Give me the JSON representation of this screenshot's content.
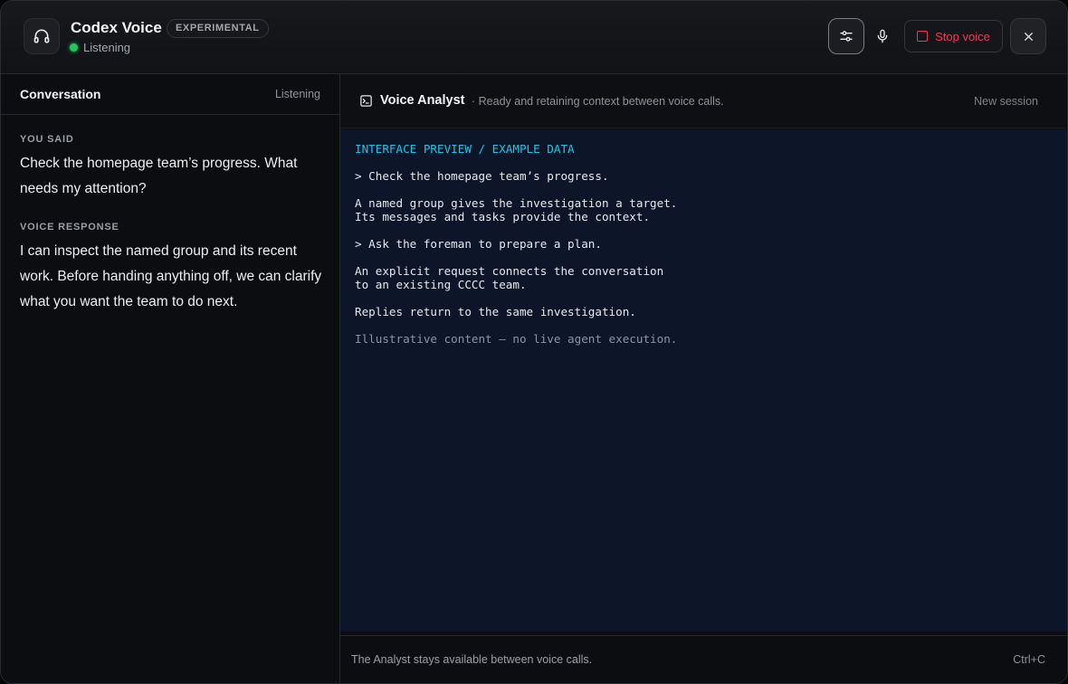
{
  "header": {
    "app_title": "Codex Voice",
    "badge": "EXPERIMENTAL",
    "status": "Listening",
    "stop_label": "Stop voice",
    "icons": [
      "headphones-icon",
      "sliders-icon",
      "mic-icon",
      "stop-icon",
      "close-icon"
    ],
    "colors": {
      "status_dot": "#22c55e",
      "stop": "#f0385a",
      "terminal_heading": "#22c3e6",
      "terminal_bg": "#0d1628"
    }
  },
  "conversation": {
    "title": "Conversation",
    "status": "Listening",
    "you_said_label": "YOU SAID",
    "you_said_text": "Check the homepage team’s progress. What needs my attention?",
    "response_label": "VOICE RESPONSE",
    "response_text": "I can inspect the named group and its recent work. Before handing anything off, we can clarify what you want the team to do next."
  },
  "analyst": {
    "title": "Voice Analyst",
    "subtitle": "· Ready and retaining context between voice calls.",
    "new_session": "New session",
    "terminal": {
      "heading": "INTERFACE PREVIEW / EXAMPLE DATA",
      "line1": "> Check the homepage team’s progress.",
      "line2": "A named group gives the investigation a target.",
      "line3": "Its messages and tasks provide the context.",
      "line4": "> Ask the foreman to prepare a plan.",
      "line5": "An explicit request connects the conversation",
      "line6": "to an existing CCCC team.",
      "line7": "Replies return to the same investigation.",
      "note": "Illustrative content — no live agent execution."
    },
    "footer_text": "The Analyst stays available between voice calls.",
    "footer_shortcut": "Ctrl+C"
  }
}
